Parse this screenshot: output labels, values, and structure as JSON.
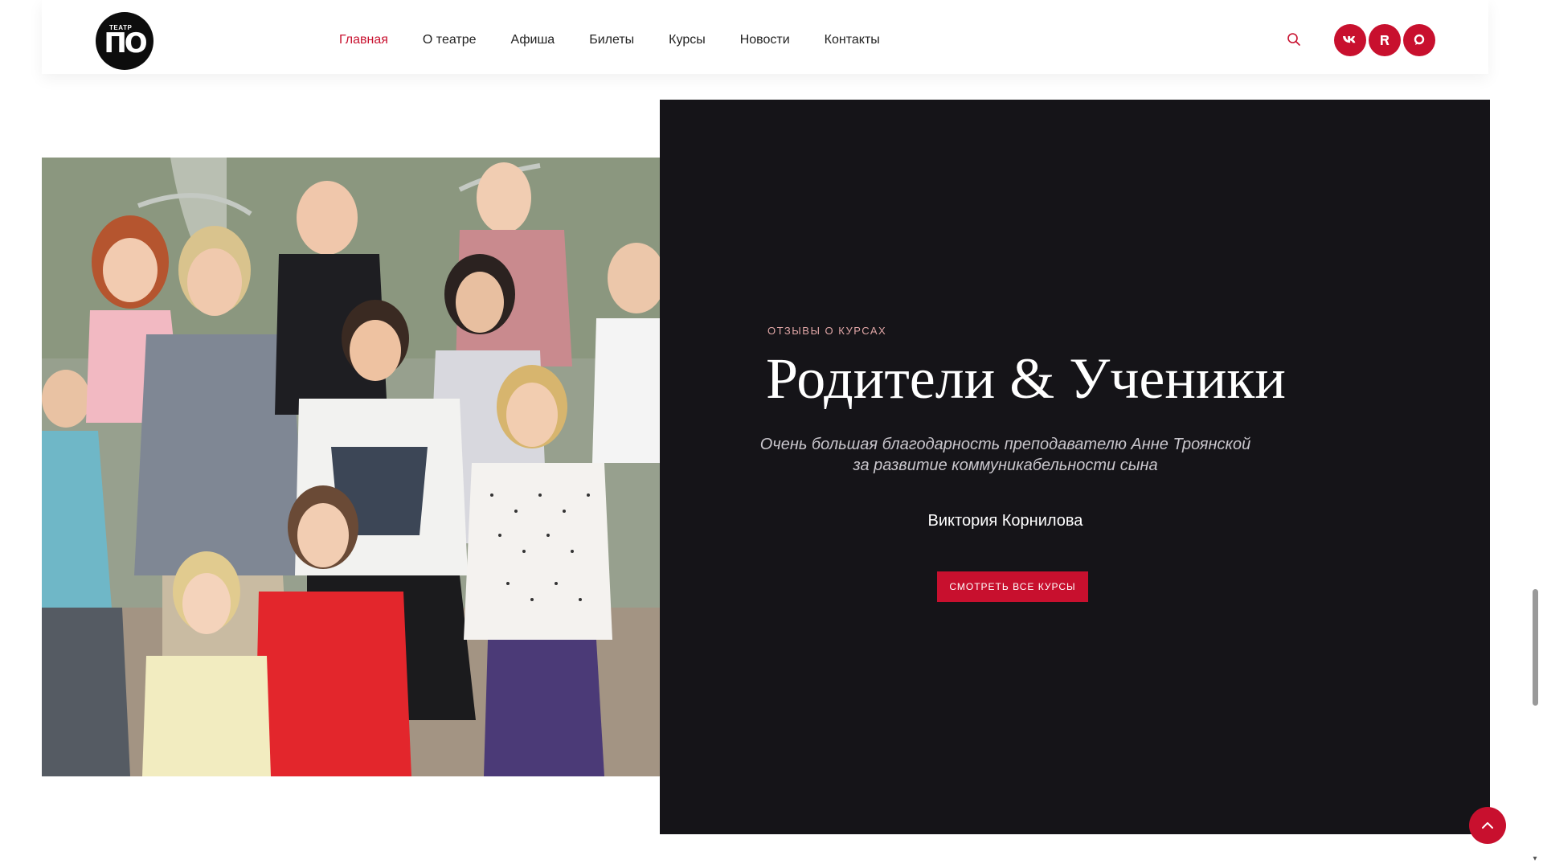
{
  "header": {
    "logo_small_text": "ТЕАТР",
    "logo_text": "ПО",
    "nav": [
      {
        "label": "Главная",
        "active": true
      },
      {
        "label": "О театре",
        "active": false
      },
      {
        "label": "Афиша",
        "active": false
      },
      {
        "label": "Билеты",
        "active": false
      },
      {
        "label": "Курсы",
        "active": false
      },
      {
        "label": "Новости",
        "active": false
      },
      {
        "label": "Контакты",
        "active": false
      }
    ],
    "search_icon": "search-icon",
    "social": [
      {
        "name": "vk-icon",
        "glyph": "vk"
      },
      {
        "name": "rutube-icon",
        "glyph": "R"
      },
      {
        "name": "ok-icon",
        "glyph": "◎"
      }
    ]
  },
  "testimonial": {
    "eyebrow": "Отзывы о курсах",
    "title": "Родители & Ученики",
    "quote_line1": "Очень большая благодарность преподавателю Анне Троянской",
    "quote_line2": "за развитие коммуникабельности сына",
    "author": "Виктория Корнилова",
    "button": "Смотреть все курсы"
  },
  "colors": {
    "accent": "#c8102e",
    "panel": "#151418",
    "eyebrow": "#e0a6a6"
  }
}
